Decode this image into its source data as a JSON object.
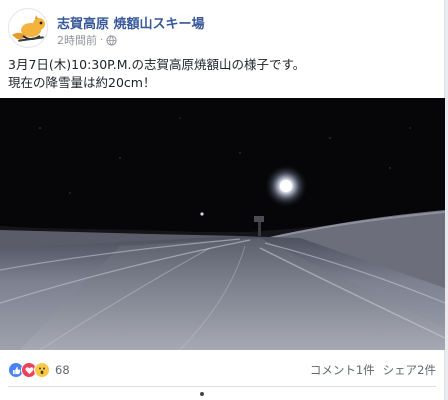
{
  "post": {
    "page_name": "志賀高原 焼額山スキー場",
    "timestamp": "2時間前",
    "separator": "·",
    "privacy_icon": "globe-icon",
    "text": "3月7日(木)10:30P.M.の志賀高原焼額山の様子です。\n現在の降雪量は約20cm！"
  },
  "media": {
    "type": "video",
    "scene": "night-snow-road"
  },
  "footer": {
    "reaction_icons": [
      "like-icon",
      "love-icon",
      "wow-icon"
    ],
    "reaction_count": "68",
    "comments": "コメント1件",
    "shares": "シェア2件"
  },
  "colors": {
    "link": "#385898",
    "like": "#4a83f2",
    "love": "#f0405b",
    "wow": "#f7c948"
  }
}
